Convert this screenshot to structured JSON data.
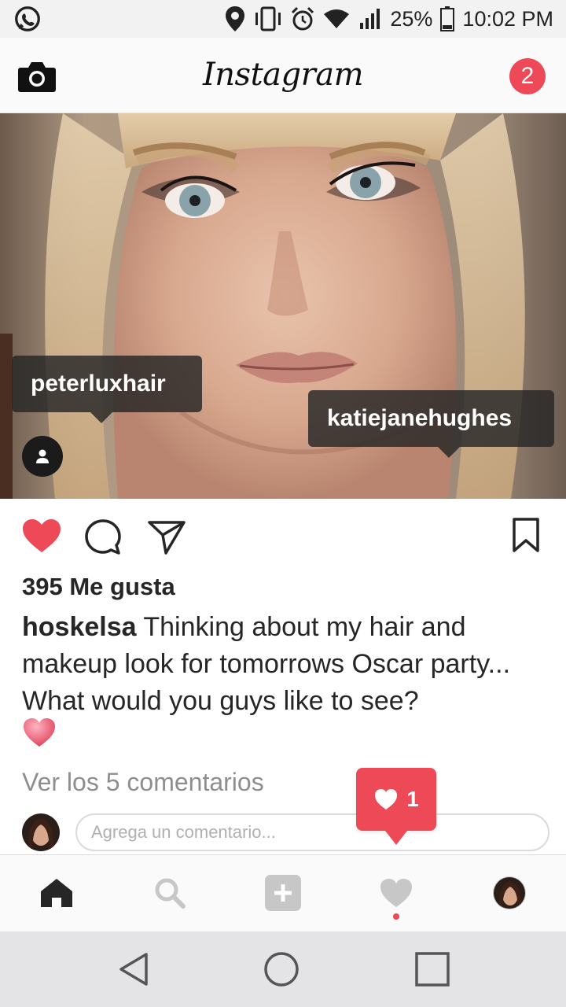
{
  "status_bar": {
    "battery": "25%",
    "time": "10:02 PM",
    "icons": [
      "whatsapp-icon",
      "location-icon",
      "vibrate-icon",
      "alarm-icon",
      "wifi-icon",
      "signal-icon",
      "battery-icon"
    ]
  },
  "header": {
    "title": "Instagram",
    "notification_count": "2",
    "icons": [
      "camera-icon"
    ]
  },
  "post": {
    "tags": [
      "peterluxhair",
      "katiejanehughes"
    ],
    "likes_text": "395 Me gusta",
    "caption_user": "hoskelsa",
    "caption_text": "Thinking about my hair and makeup look for tomorrows Oscar party... What would you guys like to see?",
    "caption_emoji": "pink-heart-emoji",
    "view_comments": "Ver los 5 comentarios",
    "comment_placeholder": "Agrega un comentario...",
    "icons": [
      "heart-icon",
      "comment-icon",
      "share-icon",
      "bookmark-icon",
      "user-tag-icon"
    ]
  },
  "activity_popover": {
    "count": "1",
    "icon": "heart-icon"
  },
  "tab_bar": {
    "items": [
      "home-icon",
      "search-icon",
      "add-icon",
      "activity-heart-icon",
      "profile-avatar"
    ]
  },
  "system_nav": {
    "items": [
      "back-icon",
      "home-circle-icon",
      "recents-icon"
    ]
  },
  "colors": {
    "accent": "#ed4956",
    "text": "#262626",
    "muted": "#8e8e8e"
  }
}
